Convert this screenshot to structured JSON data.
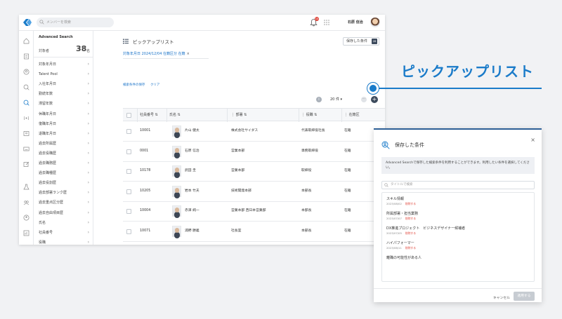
{
  "header": {
    "search_placeholder": "メンバーを検索",
    "notification_count": "10",
    "user_name": "石原 信治"
  },
  "filter_panel": {
    "title": "Advanced Search",
    "count_label": "対象者",
    "count": "38",
    "count_unit": "名",
    "items": [
      "対象年月日",
      "Talent Pool",
      "入社年月日",
      "勤続年数",
      "滞留年数",
      "休職年月日",
      "復職年月日",
      "退職年月日",
      "過去所属歴",
      "過去役職歴",
      "過去職務歴",
      "過去職種歴",
      "過去役割歴",
      "過去部署ランク歴",
      "過去重点区分歴",
      "過去自由項目歴",
      "氏名",
      "社員番号",
      "役職"
    ]
  },
  "main": {
    "title": "ピックアップリスト",
    "saved_button_label": "保存した条件",
    "saved_count": "28",
    "chip_text": "対象年月日 2024/12/04  在籍区分 在籍",
    "chip_remove": "×",
    "link_save": "検索条件の保存",
    "link_clear": "クリア",
    "info_icon": "i",
    "page_size": "20 件",
    "more_icon": "⋯",
    "add_icon": "+",
    "columns": [
      "社員番号",
      "氏名",
      "部署",
      "役職",
      "在籍区"
    ],
    "rows": [
      {
        "id": "10001",
        "name": "片山 健太",
        "dept": "株式会社サイダス",
        "role": "代表取締役社長",
        "status": "在籍"
      },
      {
        "id": "0001",
        "name": "石原 信治",
        "dept": "営業本部",
        "role": "専務取締役",
        "status": "在籍"
      },
      {
        "id": "10178",
        "name": "武田 圭",
        "dept": "営業本部",
        "role": "取締役",
        "status": "在籍"
      },
      {
        "id": "10205",
        "name": "岩本 竹夫",
        "dept": "技術開発本部",
        "role": "本部長",
        "status": "在籍"
      },
      {
        "id": "10004",
        "name": "赤澤 純一",
        "dept": "営業本部 西日本営業部",
        "role": "本部長",
        "status": "在籍"
      },
      {
        "id": "10071",
        "name": "浦野 勝義",
        "dept": "社長室",
        "role": "本部長",
        "status": "在籍"
      },
      {
        "id": "10007",
        "name": "小川 淳",
        "dept": "営業本部",
        "role": "部長",
        "status": "在籍"
      }
    ]
  },
  "dialog": {
    "title": "保存した条件",
    "close_icon": "×",
    "info": "Advanced Searchで保存した検索条件を利用することができます。利用したい条件を選択してください。",
    "search_placeholder": "タイトルで検索",
    "items": [
      {
        "title": "スキル情報",
        "date": "2023/08/02",
        "action": "削除する"
      },
      {
        "title": "所属部署・担当業務",
        "date": "2023/07/07",
        "action": "削除する"
      },
      {
        "title": "DX推進プロジェクト　ビジネスデザイナー候補者",
        "date": "2023/07/05",
        "action": "削除する"
      },
      {
        "title": "ハイパフォーマー",
        "date": "2023/06/11",
        "action": "削除する"
      },
      {
        "title": "離職の可能性がある人",
        "date": "",
        "action": ""
      }
    ],
    "cancel_label": "キャンセル",
    "submit_label": "適用する"
  },
  "callout": {
    "label": "ピックアップリスト"
  },
  "colors": {
    "accent": "#1a7bc9",
    "dark": "#3c4a5c",
    "danger": "#e0453a"
  }
}
